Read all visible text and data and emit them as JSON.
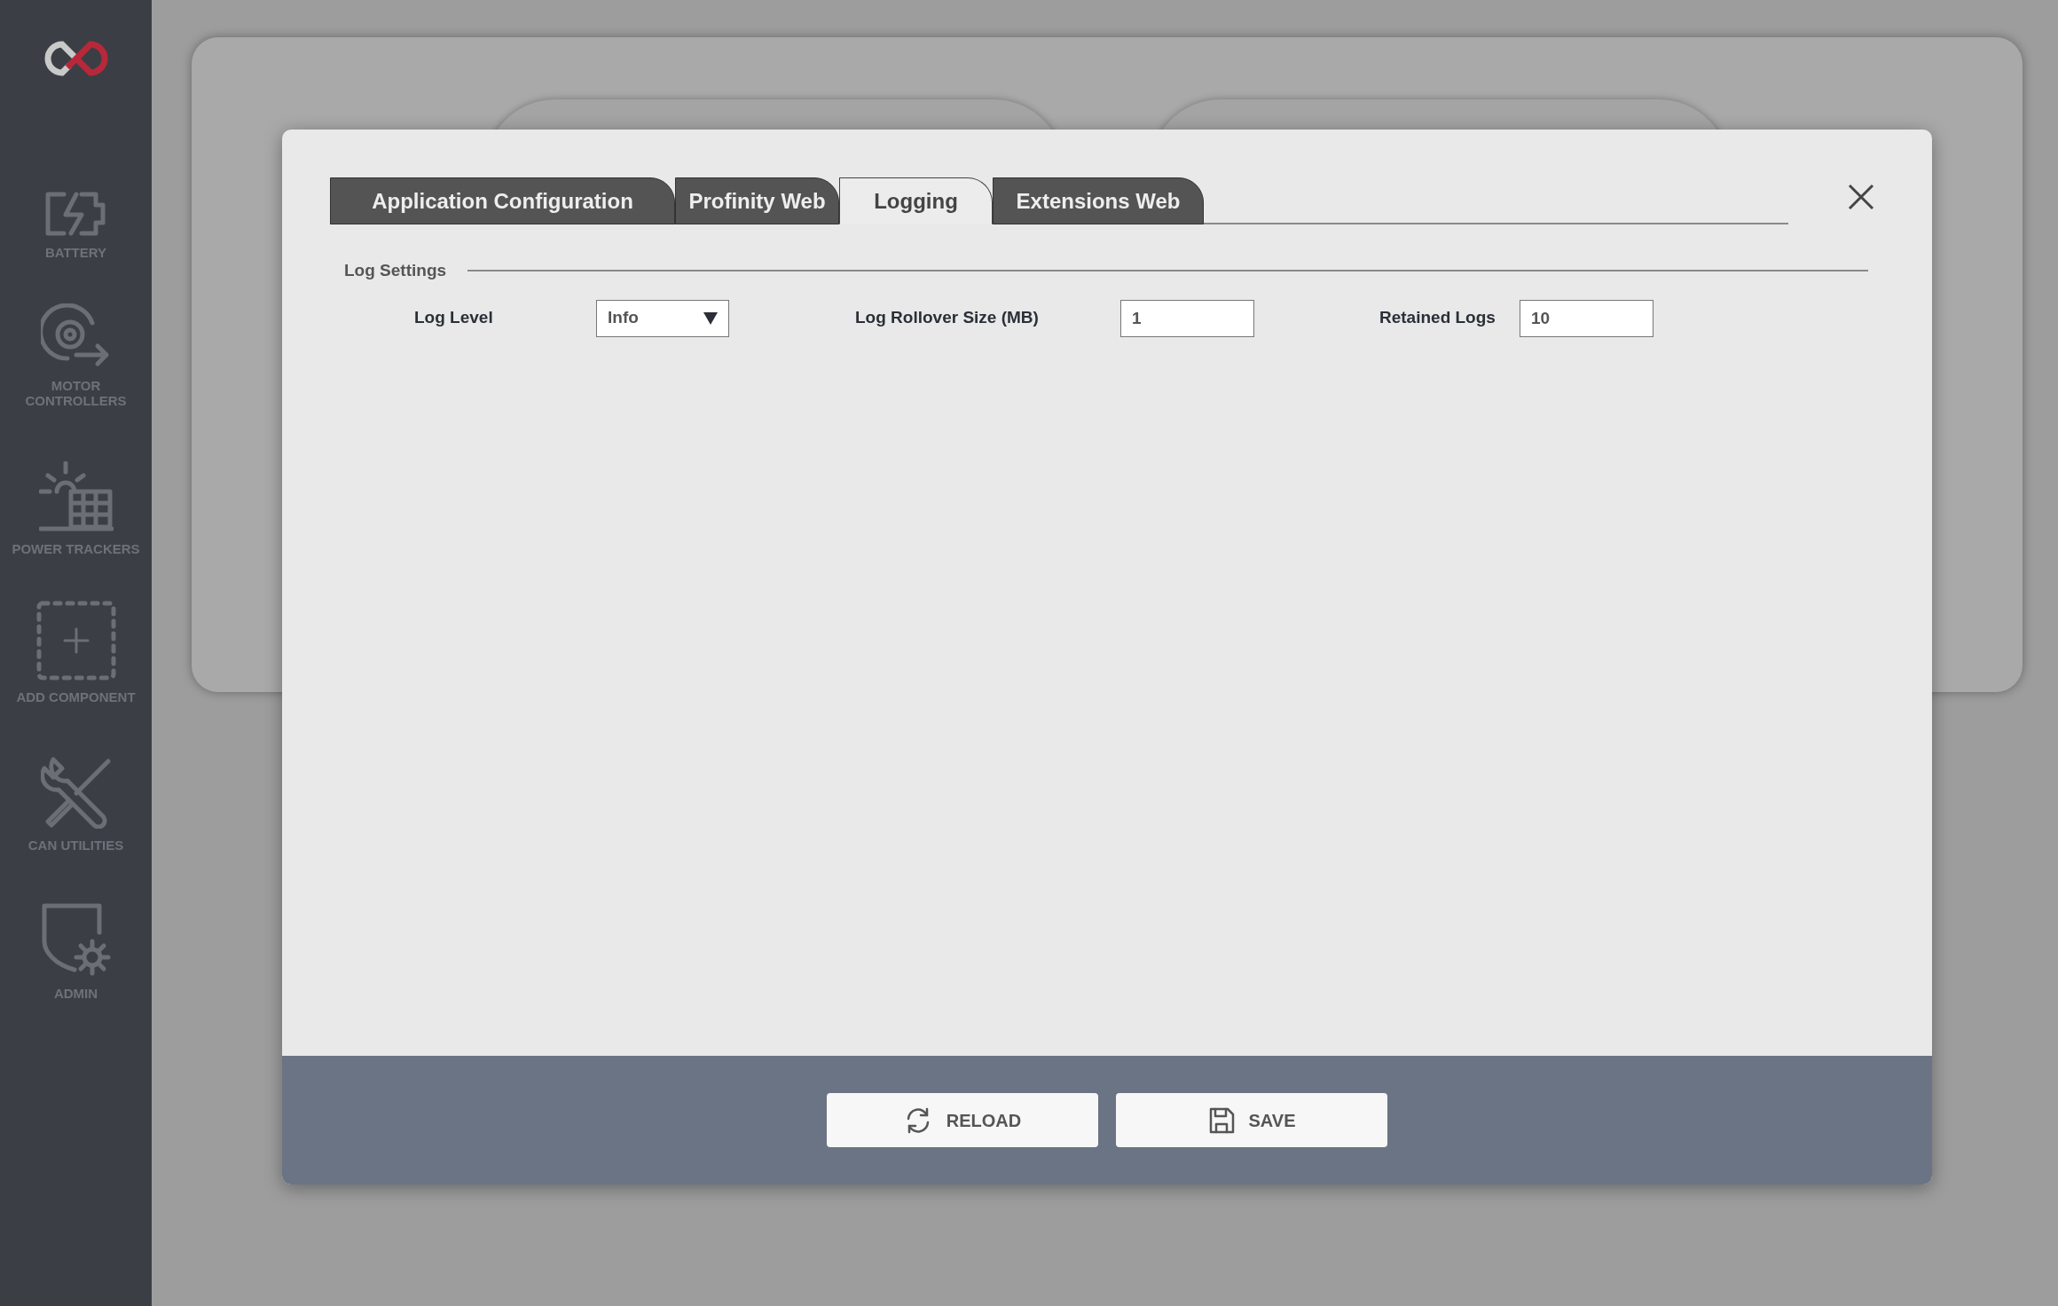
{
  "sidebar": {
    "items": [
      {
        "kind": "battery",
        "label": "BATTERY"
      },
      {
        "kind": "motor",
        "label": "MOTOR CONTROLLERS"
      },
      {
        "kind": "solar",
        "label": "POWER TRACKERS"
      },
      {
        "kind": "add",
        "label": "ADD COMPONENT"
      },
      {
        "kind": "tools",
        "label": "CAN UTILITIES"
      },
      {
        "kind": "admin",
        "label": "ADMIN"
      }
    ]
  },
  "dialog": {
    "tabs": [
      {
        "label": "Application Configuration",
        "selected": false
      },
      {
        "label": "Profinity Web",
        "selected": false
      },
      {
        "label": "Logging",
        "selected": true
      },
      {
        "label": "Extensions Web",
        "selected": false
      }
    ],
    "section": "Log Settings",
    "fields": [
      {
        "kind": "select",
        "label": "Log Level",
        "value": "Info"
      },
      {
        "kind": "input",
        "label": "Log Rollover Size (MB)",
        "value": "1"
      },
      {
        "kind": "input",
        "label": "Retained Logs",
        "value": "10"
      }
    ],
    "buttons": [
      {
        "kind": "reload",
        "label": "RELOAD"
      },
      {
        "kind": "save",
        "label": "SAVE"
      }
    ]
  }
}
